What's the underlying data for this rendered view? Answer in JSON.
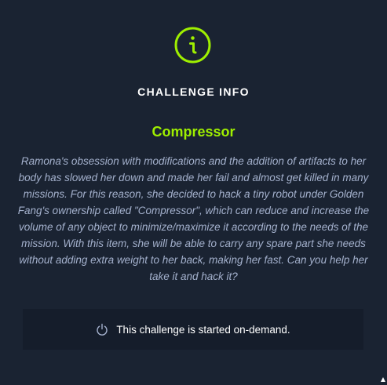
{
  "modal": {
    "heading": "CHALLENGE INFO",
    "challenge_name": "Compressor",
    "description": "Ramona's obsession with modifications and the addition of artifacts to her body has slowed her down and made her fail and almost get killed in many missions. For this reason, she decided to hack a tiny robot under Golden Fang's ownership called \"Compressor\", which can reduce and increase the volume of any object to minimize/maximize it according to the needs of the mission. With this item, she will be able to carry any spare part she needs without adding extra weight to her back, making her fast. Can you help her take it and hack it?",
    "status": {
      "icon": "power-icon",
      "text": "This challenge is started on-demand."
    },
    "header_icon": "info-icon"
  },
  "colors": {
    "background": "#1a2332",
    "accent": "#9fef00",
    "text_primary": "#ffffff",
    "text_secondary": "#a4b1cd",
    "status_box": "#151d2b"
  }
}
